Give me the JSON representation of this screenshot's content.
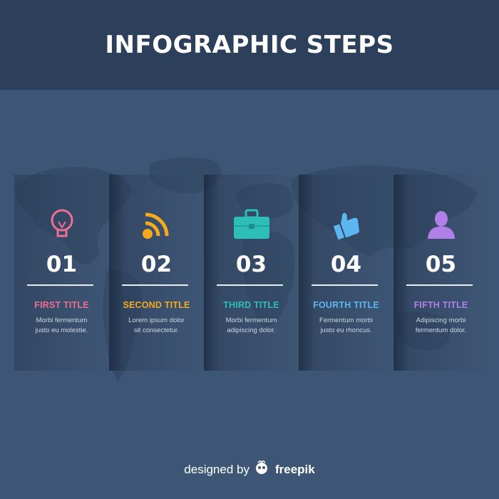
{
  "title": "INFOGRAPHIC STEPS",
  "steps": [
    {
      "number": "01",
      "title": "FIRST TITLE",
      "desc": "Morbi fermentum\njusto eu molestie.",
      "color": "#ef6f93",
      "icon": "lightbulb-icon"
    },
    {
      "number": "02",
      "title": "SECOND TITLE",
      "desc": "Lorem ipsum dolor\nsit consectetur.",
      "color": "#f5a91d",
      "icon": "rss-icon"
    },
    {
      "number": "03",
      "title": "THIRD TITLE",
      "desc": "Morbi fermentum\nadipiscing dolor.",
      "color": "#2bbfb8",
      "icon": "briefcase-icon"
    },
    {
      "number": "04",
      "title": "FOURTH TITLE",
      "desc": "Fermentum morbi\njusto eu rhoncus.",
      "color": "#5cb6ef",
      "icon": "thumbs-up-icon"
    },
    {
      "number": "05",
      "title": "FIFTH TITLE",
      "desc": "Adipiscing morbi\nfermentum  dolor.",
      "color": "#b07fe8",
      "icon": "user-icon"
    }
  ],
  "footer": {
    "prefix": "designed by",
    "brand": "freepik"
  }
}
